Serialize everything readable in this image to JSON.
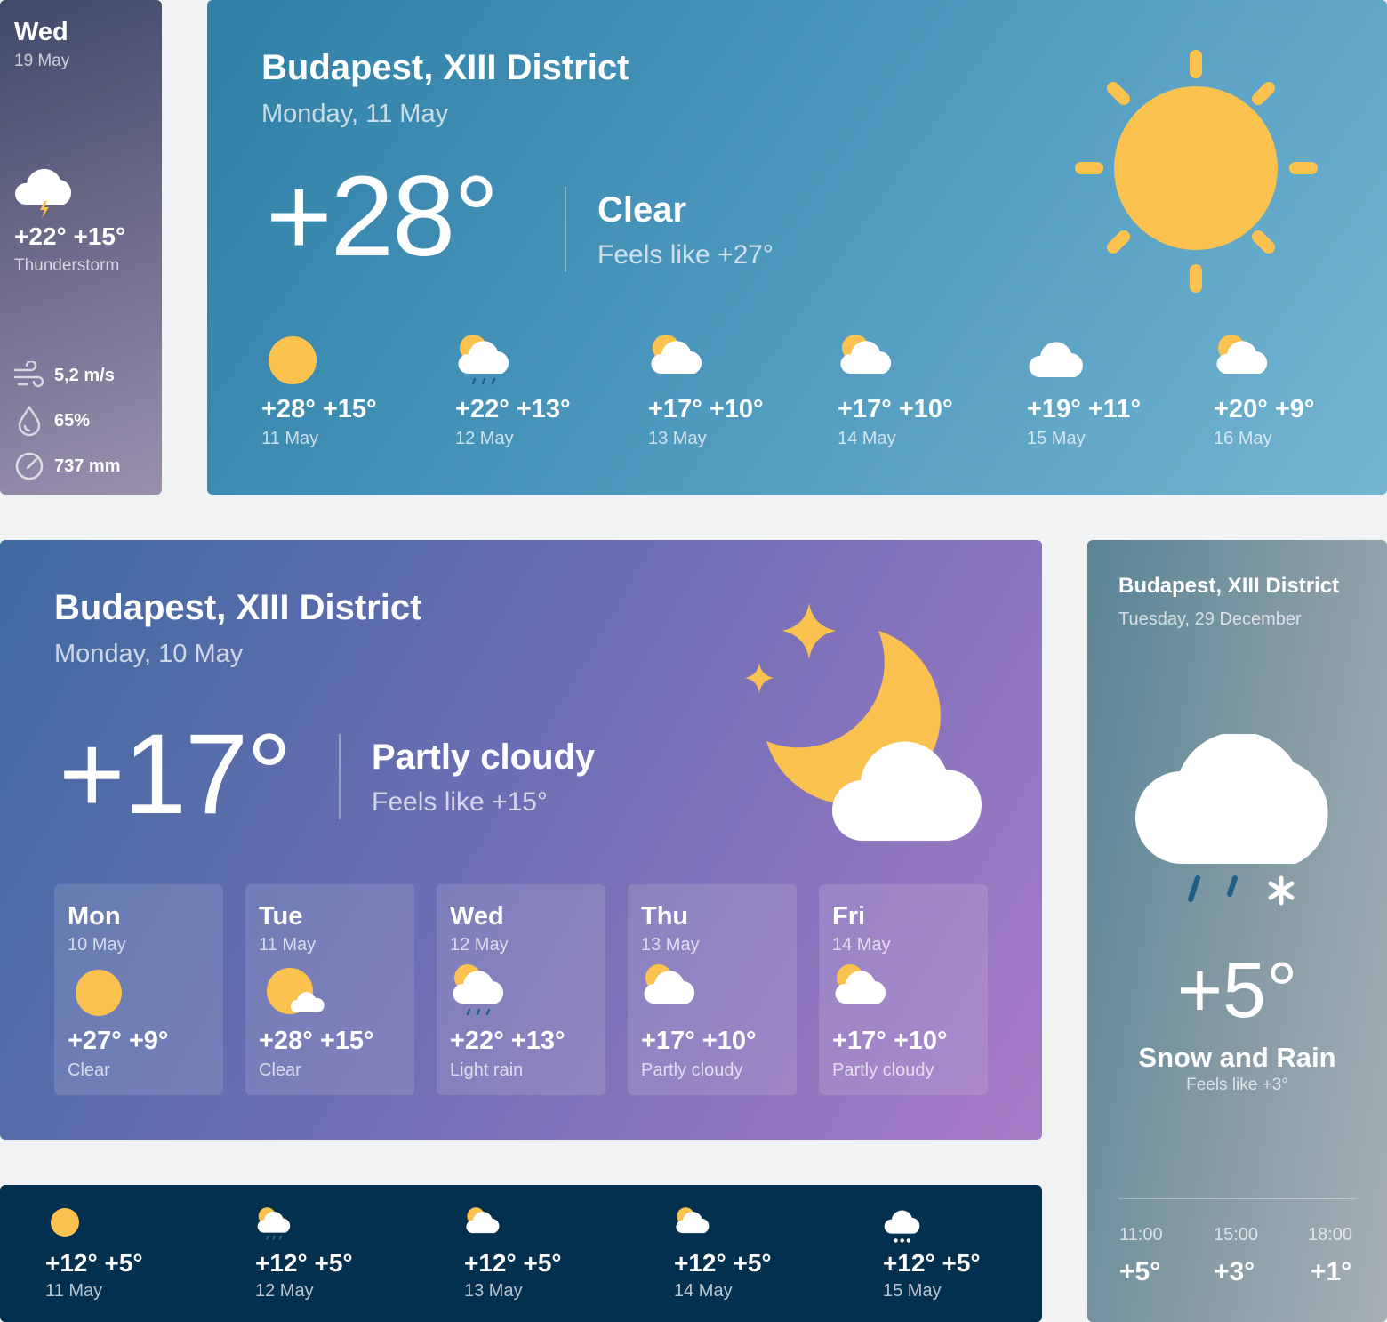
{
  "small_card": {
    "day": "Wed",
    "date": "19 May",
    "temps": "+22° +15°",
    "condition": "Thunderstorm",
    "wind": "5,2 m/s",
    "humidity": "65%",
    "pressure": "737 mm",
    "icon": "thunderstorm-cloud-icon"
  },
  "hero_card": {
    "location": "Budapest, XIII District",
    "date": "Monday, 11 May",
    "temperature": "+28°",
    "condition": "Clear",
    "feels_like": "Feels like +27°",
    "icon": "sun-icon",
    "forecast": [
      {
        "temps": "+28° +15°",
        "date": "11 May",
        "icon": "sun-icon"
      },
      {
        "temps": "+22° +13°",
        "date": "12 May",
        "icon": "sun-cloud-rain-icon"
      },
      {
        "temps": "+17° +10°",
        "date": "13 May",
        "icon": "sun-cloud-icon"
      },
      {
        "temps": "+17° +10°",
        "date": "14 May",
        "icon": "sun-cloud-icon"
      },
      {
        "temps": "+19° +11°",
        "date": "15 May",
        "icon": "cloud-icon"
      },
      {
        "temps": "+20° +9°",
        "date": "16 May",
        "icon": "sun-cloud-icon"
      }
    ]
  },
  "night_card": {
    "location": "Budapest, XIII District",
    "date": "Monday, 10 May",
    "temperature": "+17°",
    "condition": "Partly cloudy",
    "feels_like": "Feels like +15°",
    "icon": "moon-cloud-stars-icon",
    "days": [
      {
        "day": "Mon",
        "date": "10 May",
        "temps": "+27° +9°",
        "condition": "Clear",
        "icon": "sun-icon"
      },
      {
        "day": "Tue",
        "date": "11 May",
        "temps": "+28° +15°",
        "condition": "Clear",
        "icon": "sun-small-cloud-icon"
      },
      {
        "day": "Wed",
        "date": "12 May",
        "temps": "+22° +13°",
        "condition": "Light rain",
        "icon": "sun-cloud-rain-icon"
      },
      {
        "day": "Thu",
        "date": "13 May",
        "temps": "+17° +10°",
        "condition": "Partly cloudy",
        "icon": "sun-cloud-icon"
      },
      {
        "day": "Fri",
        "date": "14 May",
        "temps": "+17° +10°",
        "condition": "Partly cloudy",
        "icon": "sun-cloud-icon"
      }
    ]
  },
  "snow_card": {
    "location": "Budapest, XIII District",
    "date": "Tuesday, 29 December",
    "temperature": "+5°",
    "condition": "Snow and Rain",
    "feels_like": "Feels like +3°",
    "icon": "cloud-rain-snow-icon",
    "hours": [
      {
        "time": "11:00",
        "temp": "+5°"
      },
      {
        "time": "15:00",
        "temp": "+3°"
      },
      {
        "time": "18:00",
        "temp": "+1°"
      }
    ]
  },
  "strip_card": {
    "forecast": [
      {
        "temps": "+12° +5°",
        "date": "11 May",
        "icon": "sun-icon"
      },
      {
        "temps": "+12° +5°",
        "date": "12 May",
        "icon": "sun-cloud-rain-icon"
      },
      {
        "temps": "+12° +5°",
        "date": "13 May",
        "icon": "sun-cloud-icon"
      },
      {
        "temps": "+12° +5°",
        "date": "14 May",
        "icon": "sun-cloud-icon"
      },
      {
        "temps": "+12° +5°",
        "date": "15 May",
        "icon": "cloud-snow-icon"
      }
    ]
  },
  "colors": {
    "sun": "#fcc24f",
    "cloud": "#ffffff",
    "rain": "#1f5f86",
    "strip_bg": "#04304f"
  }
}
